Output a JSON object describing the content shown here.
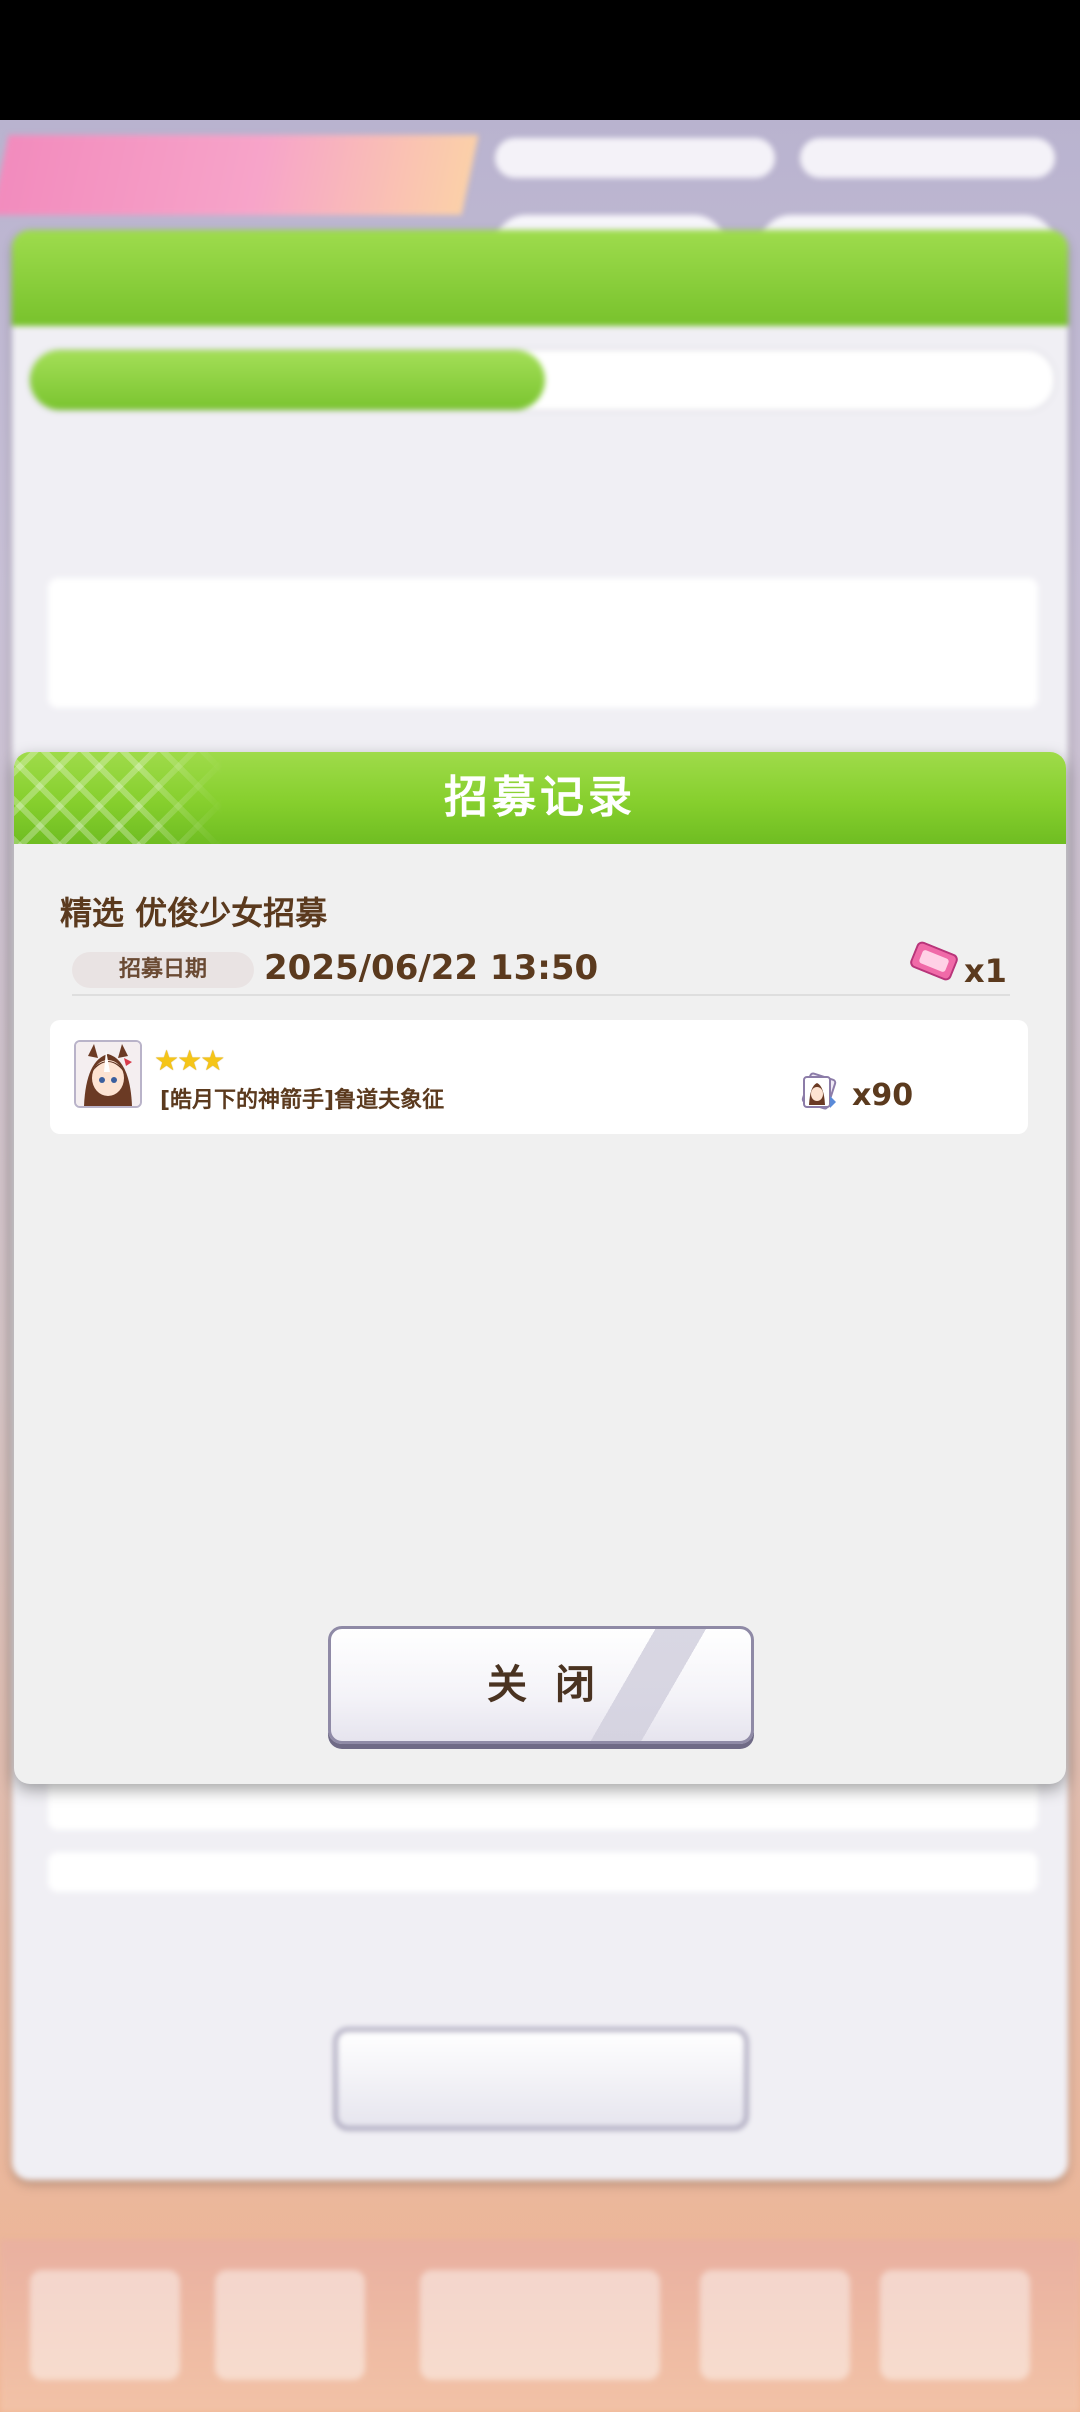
{
  "dialog": {
    "title": "招募记录",
    "record": {
      "name": "精选 优俊少女招募",
      "date_label": "招募日期",
      "date": "2025/06/22  13:50",
      "cost_qty": "x1"
    },
    "result": {
      "stars": "★★★",
      "rarity_stars": 3,
      "character": "[皓月下的神箭手]鲁道夫象征",
      "piece_qty": "x90"
    },
    "close_label": "关闭"
  },
  "colors": {
    "header_green": "#86cf2d",
    "text_brown": "#5b3a1e",
    "star_gold": "#f5c518"
  }
}
